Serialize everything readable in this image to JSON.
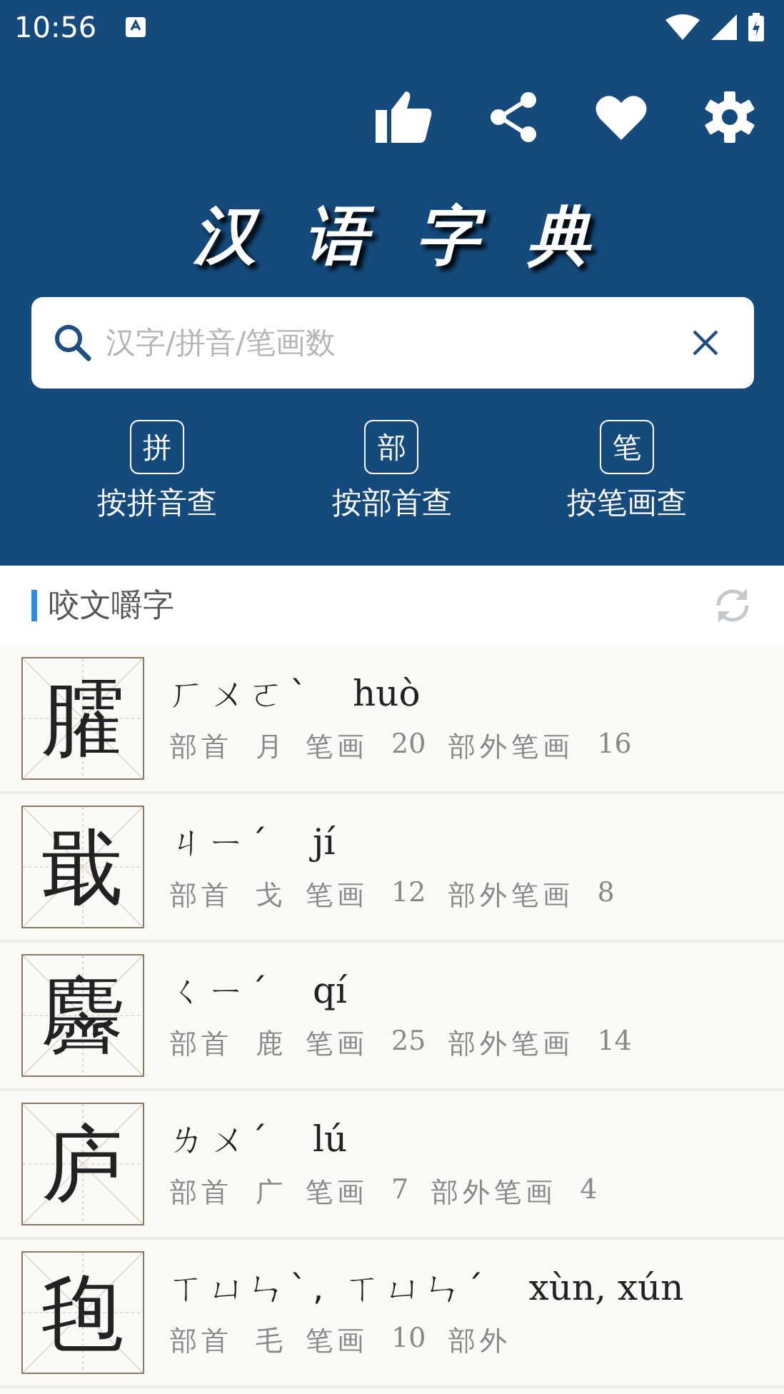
{
  "status_bar": {
    "time": "10:56"
  },
  "title": "汉语字典",
  "search": {
    "placeholder": "汉字/拼音/笔画数"
  },
  "modes": [
    {
      "glyph": "拼",
      "label": "按拼音查"
    },
    {
      "glyph": "部",
      "label": "按部首查"
    },
    {
      "glyph": "笔",
      "label": "按笔画查"
    }
  ],
  "section": {
    "title": "咬文嚼字"
  },
  "entries": [
    {
      "char": "臛",
      "zhuyin": "ㄏㄨㄛˋ",
      "pinyin": "huò",
      "fields": [
        "部首",
        "月",
        "笔画",
        "20",
        "部外笔画",
        "16"
      ]
    },
    {
      "char": "戢",
      "zhuyin": "ㄐㄧˊ",
      "pinyin": "jí",
      "fields": [
        "部首",
        "戈",
        "笔画",
        "12",
        "部外笔画",
        "8"
      ]
    },
    {
      "char": "麡",
      "zhuyin": "ㄑㄧˊ",
      "pinyin": "qí",
      "fields": [
        "部首",
        "鹿",
        "笔画",
        "25",
        "部外笔画",
        "14"
      ]
    },
    {
      "char": "庐",
      "zhuyin": "ㄌㄨˊ",
      "pinyin": "lú",
      "fields": [
        "部首",
        "广",
        "笔画",
        "7",
        "部外笔画",
        "4"
      ]
    },
    {
      "char": "毥",
      "zhuyin": "ㄒㄩㄣˋ, ㄒㄩㄣˊ",
      "pinyin": "xùn, xún",
      "fields": [
        "部首",
        "毛",
        "笔画",
        "10",
        "部外"
      ]
    }
  ]
}
